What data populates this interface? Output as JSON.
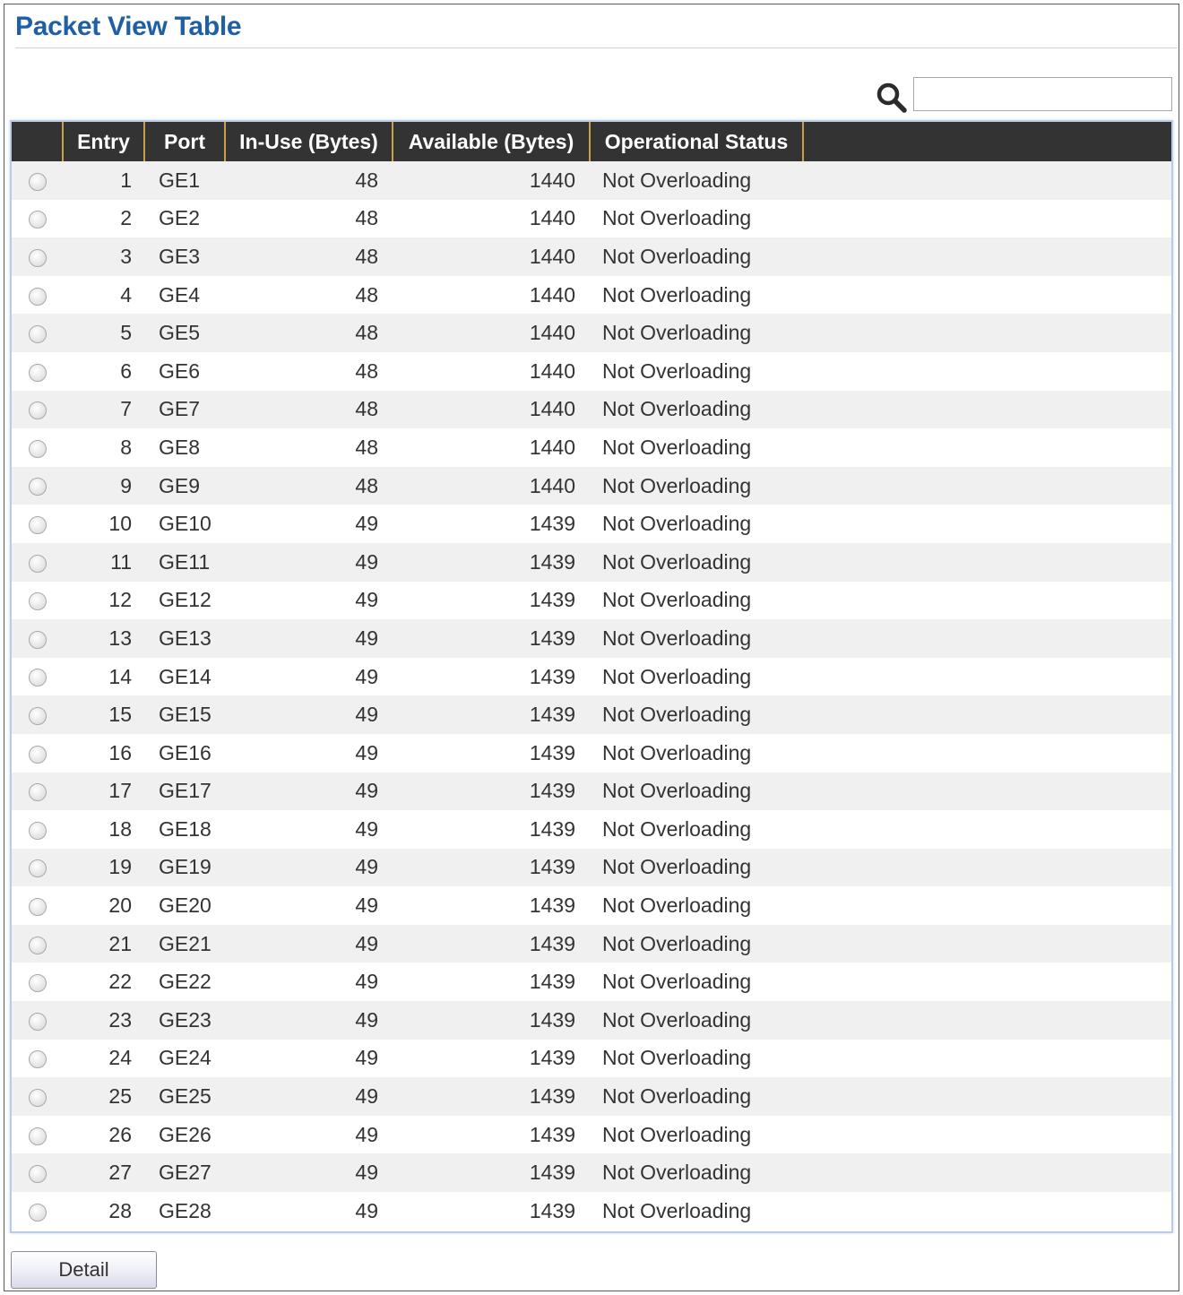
{
  "page": {
    "title": "Packet View Table"
  },
  "search": {
    "value": "",
    "icon": "search-icon"
  },
  "table": {
    "columns": [
      "",
      "Entry",
      "Port",
      "In-Use (Bytes)",
      "Available (Bytes)",
      "Operational Status",
      ""
    ],
    "rows": [
      {
        "entry": "1",
        "port": "GE1",
        "in_use": "48",
        "available": "1440",
        "status": "Not Overloading"
      },
      {
        "entry": "2",
        "port": "GE2",
        "in_use": "48",
        "available": "1440",
        "status": "Not Overloading"
      },
      {
        "entry": "3",
        "port": "GE3",
        "in_use": "48",
        "available": "1440",
        "status": "Not Overloading"
      },
      {
        "entry": "4",
        "port": "GE4",
        "in_use": "48",
        "available": "1440",
        "status": "Not Overloading"
      },
      {
        "entry": "5",
        "port": "GE5",
        "in_use": "48",
        "available": "1440",
        "status": "Not Overloading"
      },
      {
        "entry": "6",
        "port": "GE6",
        "in_use": "48",
        "available": "1440",
        "status": "Not Overloading"
      },
      {
        "entry": "7",
        "port": "GE7",
        "in_use": "48",
        "available": "1440",
        "status": "Not Overloading"
      },
      {
        "entry": "8",
        "port": "GE8",
        "in_use": "48",
        "available": "1440",
        "status": "Not Overloading"
      },
      {
        "entry": "9",
        "port": "GE9",
        "in_use": "48",
        "available": "1440",
        "status": "Not Overloading"
      },
      {
        "entry": "10",
        "port": "GE10",
        "in_use": "49",
        "available": "1439",
        "status": "Not Overloading"
      },
      {
        "entry": "11",
        "port": "GE11",
        "in_use": "49",
        "available": "1439",
        "status": "Not Overloading"
      },
      {
        "entry": "12",
        "port": "GE12",
        "in_use": "49",
        "available": "1439",
        "status": "Not Overloading"
      },
      {
        "entry": "13",
        "port": "GE13",
        "in_use": "49",
        "available": "1439",
        "status": "Not Overloading"
      },
      {
        "entry": "14",
        "port": "GE14",
        "in_use": "49",
        "available": "1439",
        "status": "Not Overloading"
      },
      {
        "entry": "15",
        "port": "GE15",
        "in_use": "49",
        "available": "1439",
        "status": "Not Overloading"
      },
      {
        "entry": "16",
        "port": "GE16",
        "in_use": "49",
        "available": "1439",
        "status": "Not Overloading"
      },
      {
        "entry": "17",
        "port": "GE17",
        "in_use": "49",
        "available": "1439",
        "status": "Not Overloading"
      },
      {
        "entry": "18",
        "port": "GE18",
        "in_use": "49",
        "available": "1439",
        "status": "Not Overloading"
      },
      {
        "entry": "19",
        "port": "GE19",
        "in_use": "49",
        "available": "1439",
        "status": "Not Overloading"
      },
      {
        "entry": "20",
        "port": "GE20",
        "in_use": "49",
        "available": "1439",
        "status": "Not Overloading"
      },
      {
        "entry": "21",
        "port": "GE21",
        "in_use": "49",
        "available": "1439",
        "status": "Not Overloading"
      },
      {
        "entry": "22",
        "port": "GE22",
        "in_use": "49",
        "available": "1439",
        "status": "Not Overloading"
      },
      {
        "entry": "23",
        "port": "GE23",
        "in_use": "49",
        "available": "1439",
        "status": "Not Overloading"
      },
      {
        "entry": "24",
        "port": "GE24",
        "in_use": "49",
        "available": "1439",
        "status": "Not Overloading"
      },
      {
        "entry": "25",
        "port": "GE25",
        "in_use": "49",
        "available": "1439",
        "status": "Not Overloading"
      },
      {
        "entry": "26",
        "port": "GE26",
        "in_use": "49",
        "available": "1439",
        "status": "Not Overloading"
      },
      {
        "entry": "27",
        "port": "GE27",
        "in_use": "49",
        "available": "1439",
        "status": "Not Overloading"
      },
      {
        "entry": "28",
        "port": "GE28",
        "in_use": "49",
        "available": "1439",
        "status": "Not Overloading"
      }
    ]
  },
  "buttons": {
    "detail_label": "Detail"
  },
  "colors": {
    "title": "#1f5fa6",
    "header_bg": "#333333",
    "header_divider": "#c8a04a",
    "row_odd": "#f0f0f0",
    "row_even": "#ffffff",
    "table_border": "#b9cbe6"
  }
}
